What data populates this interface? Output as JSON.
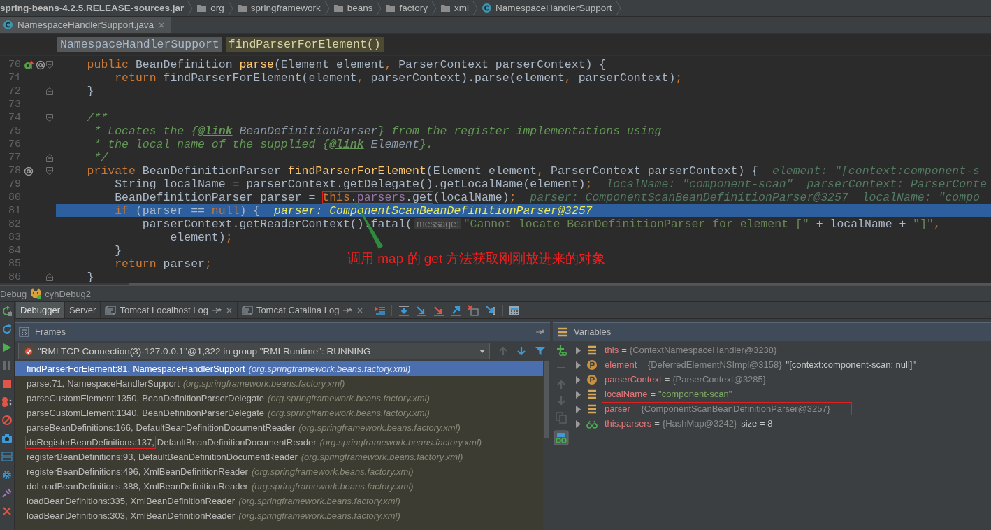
{
  "breadcrumbs": [
    {
      "kind": "jar",
      "label": "spring-beans-4.2.5.RELEASE-sources.jar"
    },
    {
      "kind": "folder",
      "label": "org"
    },
    {
      "kind": "folder",
      "label": "springframework"
    },
    {
      "kind": "folder",
      "label": "beans"
    },
    {
      "kind": "folder",
      "label": "factory"
    },
    {
      "kind": "folder",
      "label": "xml"
    },
    {
      "kind": "class",
      "label": "NamespaceHandlerSupport"
    }
  ],
  "file_tabs": [
    {
      "label": "NamespaceHandlerSupport.java",
      "selected": true
    }
  ],
  "structure_path": [
    {
      "label": "NamespaceHandlerSupport",
      "selected": false
    },
    {
      "label": "findParserForElement()",
      "selected": true
    }
  ],
  "editor": {
    "lines": [
      {
        "number": "70",
        "gutter_icons": [
          {
            "kind": "override"
          },
          {
            "kind": "annotated"
          }
        ],
        "fold_start": true,
        "current": false,
        "tokens": [
          {
            "kind": "kw",
            "text": "    public "
          },
          {
            "kind": "plain",
            "text": "BeanDefinition "
          },
          {
            "kind": "decl",
            "text": "parse"
          },
          {
            "kind": "plain",
            "text": "(Element element"
          },
          {
            "kind": "punct",
            "text": ", "
          },
          {
            "kind": "plain",
            "text": "ParserContext parserContext) {"
          }
        ]
      },
      {
        "number": "71",
        "current": false,
        "tokens": [
          {
            "kind": "kw",
            "text": "        return "
          },
          {
            "kind": "plain",
            "text": "findParserForElement(element"
          },
          {
            "kind": "punct",
            "text": ", "
          },
          {
            "kind": "plain",
            "text": "parserContext).parse(element"
          },
          {
            "kind": "punct",
            "text": ", "
          },
          {
            "kind": "plain",
            "text": "parserContext)"
          },
          {
            "kind": "punct",
            "text": ";"
          }
        ]
      },
      {
        "number": "72",
        "fold_end": true,
        "current": false,
        "tokens": [
          {
            "kind": "plain",
            "text": "    }"
          }
        ]
      },
      {
        "number": "73",
        "current": false
      },
      {
        "number": "74",
        "fold_start": true,
        "current": false,
        "tokens": [
          {
            "kind": "comment",
            "text": "    /**"
          }
        ]
      },
      {
        "number": "75",
        "current": false,
        "tokens": [
          {
            "kind": "comment",
            "text": "     * Locates the {"
          },
          {
            "kind": "doctag",
            "text": "@link"
          },
          {
            "kind": "docref",
            "text": " BeanDefinitionParser"
          },
          {
            "kind": "comment",
            "text": "} from the register implementations using"
          }
        ]
      },
      {
        "number": "76",
        "current": false,
        "tokens": [
          {
            "kind": "comment",
            "text": "     * the local name of the supplied {"
          },
          {
            "kind": "doctag",
            "text": "@link"
          },
          {
            "kind": "docref",
            "text": " Element"
          },
          {
            "kind": "comment",
            "text": "}."
          }
        ]
      },
      {
        "number": "77",
        "fold_end": true,
        "current": false,
        "tokens": [
          {
            "kind": "comment",
            "text": "     */"
          }
        ]
      },
      {
        "number": "78",
        "gutter_icons": [
          {
            "kind": "annotated"
          }
        ],
        "fold_start": true,
        "current": false,
        "tokens": [
          {
            "kind": "kw",
            "text": "    private "
          },
          {
            "kind": "plain",
            "text": "BeanDefinitionParser "
          },
          {
            "kind": "decl",
            "text": "findParserForElement"
          },
          {
            "kind": "plain",
            "text": "(Element element"
          },
          {
            "kind": "punct",
            "text": ", "
          },
          {
            "kind": "plain",
            "text": "ParserContext parserContext) {"
          },
          {
            "kind": "hint",
            "text": "  element: \"[context:component-s"
          }
        ]
      },
      {
        "number": "79",
        "current": false,
        "tokens": [
          {
            "kind": "plain",
            "text": "        String localName = parserContext.getDelegate().getLocalName(element)"
          },
          {
            "kind": "punct",
            "text": ";"
          },
          {
            "kind": "hint",
            "text": "  localName: \"component-scan\"  parserContext: ParserConte"
          }
        ]
      },
      {
        "number": "80",
        "current": false,
        "tokens": [
          {
            "kind": "plain",
            "text": "        BeanDefinitionParser parser = "
          },
          {
            "kind": "kw",
            "text": "this",
            "boxed": true
          },
          {
            "kind": "plain",
            "text": ".",
            "boxed": true
          },
          {
            "kind": "field",
            "text": "parsers",
            "boxed": true
          },
          {
            "kind": "plain",
            "text": ".get",
            "boxed": true
          },
          {
            "kind": "plain",
            "text": "(localName)"
          },
          {
            "kind": "punct",
            "text": ";"
          },
          {
            "kind": "hint",
            "text": "  parser: ComponentScanBeanDefinitionParser@3257  localName: \"compo"
          }
        ]
      },
      {
        "number": "81",
        "current": true,
        "tokens": [
          {
            "kind": "kw",
            "text": "        if "
          },
          {
            "kind": "plain",
            "text": "(parser == "
          },
          {
            "kind": "kw",
            "text": "null"
          },
          {
            "kind": "plain",
            "text": ") {"
          },
          {
            "kind": "hint",
            "text": "  parser: ComponentScanBeanDefinitionParser@3257"
          }
        ]
      },
      {
        "number": "82",
        "current": false,
        "tokens": [
          {
            "kind": "plain",
            "text": "            parserContext.getReaderContext().fatal("
          },
          {
            "kind": "param",
            "text": "message:"
          },
          {
            "kind": "string",
            "text": "\"Cannot locate BeanDefinitionParser for element [\""
          },
          {
            "kind": "plain",
            "text": " + localName + "
          },
          {
            "kind": "string",
            "text": "\"]\""
          },
          {
            "kind": "punct",
            "text": ","
          }
        ]
      },
      {
        "number": "83",
        "current": false,
        "tokens": [
          {
            "kind": "plain",
            "text": "                element)"
          },
          {
            "kind": "punct",
            "text": ";"
          }
        ]
      },
      {
        "number": "84",
        "current": false,
        "tokens": [
          {
            "kind": "plain",
            "text": "        }"
          }
        ]
      },
      {
        "number": "85",
        "current": false,
        "tokens": [
          {
            "kind": "kw",
            "text": "        return "
          },
          {
            "kind": "plain",
            "text": "parser"
          },
          {
            "kind": "punct",
            "text": ";"
          }
        ]
      },
      {
        "number": "86",
        "fold_end": true,
        "current": false,
        "tokens": [
          {
            "kind": "plain",
            "text": "    }"
          }
        ]
      }
    ],
    "annotation": {
      "text": "调用 map 的 get 方法获取刚刚放进来的对象"
    }
  },
  "debug": {
    "title": "Debug",
    "config": "cyhDebug2",
    "tabs": [
      {
        "kind": "plain",
        "label": "Debugger",
        "selected": true
      },
      {
        "kind": "plain",
        "label": "Server",
        "selected": false
      },
      {
        "kind": "log",
        "label": "Tomcat Localhost Log",
        "selected": false
      },
      {
        "kind": "log",
        "label": "Tomcat Catalina Log",
        "selected": false
      }
    ],
    "frames_panel": {
      "title": "Frames",
      "thread": "\"RMI TCP Connection(3)-127.0.0.1\"@1,322 in group \"RMI Runtime\": RUNNING",
      "frames": [
        {
          "method": "findParserForElement:81,",
          "class": "NamespaceHandlerSupport",
          "package": "(org.springframework.beans.factory.xml)",
          "selected": true,
          "boxed": false
        },
        {
          "method": "parse:71,",
          "class": "NamespaceHandlerSupport",
          "package": "(org.springframework.beans.factory.xml)",
          "selected": false,
          "boxed": false
        },
        {
          "method": "parseCustomElement:1350,",
          "class": "BeanDefinitionParserDelegate",
          "package": "(org.springframework.beans.factory.xml)",
          "selected": false,
          "boxed": false
        },
        {
          "method": "parseCustomElement:1340,",
          "class": "BeanDefinitionParserDelegate",
          "package": "(org.springframework.beans.factory.xml)",
          "selected": false,
          "boxed": false
        },
        {
          "method": "parseBeanDefinitions:166,",
          "class": "DefaultBeanDefinitionDocumentReader",
          "package": "(org.springframework.beans.factory.xml)",
          "selected": false,
          "boxed": false
        },
        {
          "method": "doRegisterBeanDefinitions:137,",
          "class": "DefaultBeanDefinitionDocumentReader",
          "package": "(org.springframework.beans.factory.xml)",
          "selected": false,
          "boxed": true
        },
        {
          "method": "registerBeanDefinitions:93,",
          "class": "DefaultBeanDefinitionDocumentReader",
          "package": "(org.springframework.beans.factory.xml)",
          "selected": false,
          "boxed": false
        },
        {
          "method": "registerBeanDefinitions:496,",
          "class": "XmlBeanDefinitionReader",
          "package": "(org.springframework.beans.factory.xml)",
          "selected": false,
          "boxed": false
        },
        {
          "method": "doLoadBeanDefinitions:388,",
          "class": "XmlBeanDefinitionReader",
          "package": "(org.springframework.beans.factory.xml)",
          "selected": false,
          "boxed": false
        },
        {
          "method": "loadBeanDefinitions:335,",
          "class": "XmlBeanDefinitionReader",
          "package": "(org.springframework.beans.factory.xml)",
          "selected": false,
          "boxed": false
        },
        {
          "method": "loadBeanDefinitions:303,",
          "class": "XmlBeanDefinitionReader",
          "package": "(org.springframework.beans.factory.xml)",
          "selected": false,
          "boxed": false
        }
      ]
    },
    "variables_panel": {
      "title": "Variables",
      "variables": [
        {
          "kind": "field",
          "name": "this",
          "operator": "=",
          "value": "{ContextNamespaceHandler@3238}",
          "string_value": false,
          "expanded": false,
          "boxed": false
        },
        {
          "kind": "param",
          "name": "element",
          "operator": "=",
          "value": "{DeferredElementNSImpl@3158}",
          "string_value": false,
          "extra": "\"[context:component-scan: null]\"",
          "expanded": false,
          "boxed": false
        },
        {
          "kind": "param",
          "name": "parserContext",
          "operator": "=",
          "value": "{ParserContext@3285}",
          "string_value": false,
          "expanded": false,
          "boxed": false
        },
        {
          "kind": "field",
          "name": "localName",
          "operator": "=",
          "value": "\"component-scan\"",
          "string_value": true,
          "expanded": false,
          "boxed": false
        },
        {
          "kind": "field",
          "name": "parser",
          "operator": "=",
          "value": "{ComponentScanBeanDefinitionParser@3257}",
          "string_value": false,
          "expanded": false,
          "boxed": true
        },
        {
          "kind": "watch",
          "name": "this.parsers",
          "operator": "=",
          "value": "{HashMap@3242}",
          "string_value": false,
          "extra": "size = 8",
          "expanded": false,
          "boxed": false
        }
      ]
    }
  }
}
